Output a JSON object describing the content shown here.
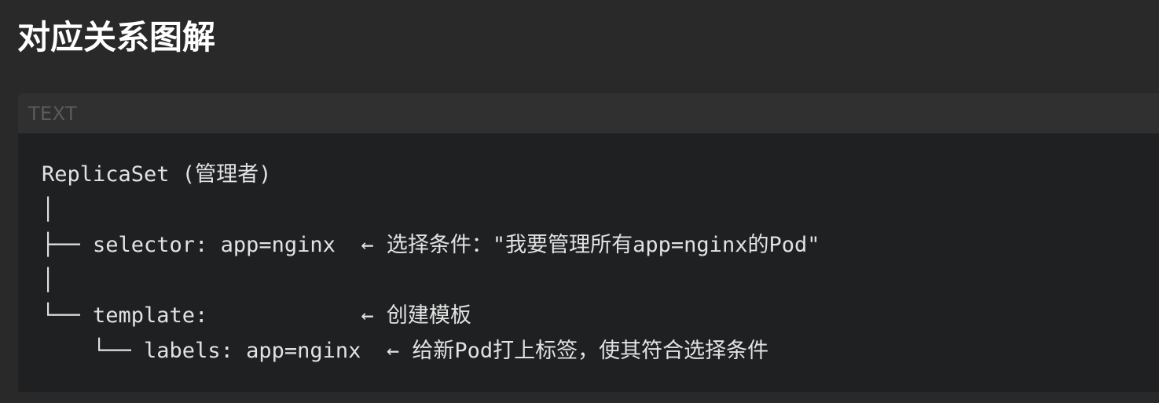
{
  "page": {
    "title": "对应关系图解"
  },
  "code_block": {
    "language_label": "TEXT",
    "lines": [
      "ReplicaSet (管理者)",
      "│",
      "├── selector: app=nginx  ← 选择条件：\"我要管理所有app=nginx的Pod\"",
      "│",
      "└── template:            ← 创建模板",
      "    └── labels: app=nginx  ← 给新Pod打上标签，使其符合选择条件"
    ]
  }
}
